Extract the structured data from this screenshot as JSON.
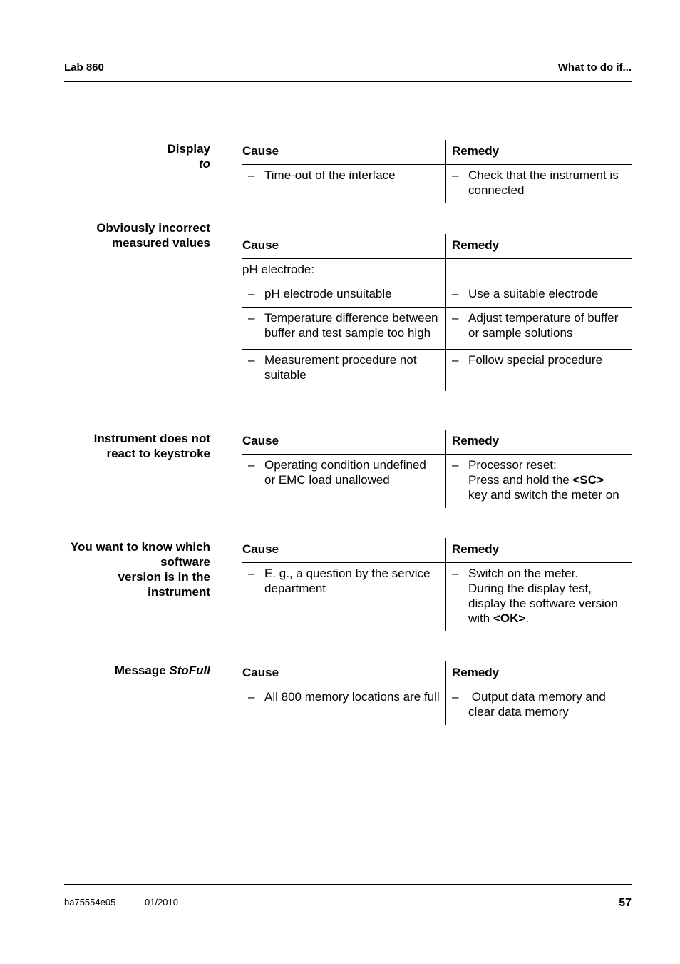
{
  "header": {
    "left": "Lab 860",
    "right": "What to do if..."
  },
  "footer": {
    "doc_id": "ba75554e05",
    "date": "01/2010",
    "page": "57"
  },
  "columns": {
    "cause": "Cause",
    "remedy": "Remedy"
  },
  "dash": "–",
  "sections": [
    {
      "label_line1": "Display",
      "label_line2_italic": "to",
      "rows": [
        {
          "cause": "Time-out of the interface",
          "remedy": "Check that the instrument is connected"
        }
      ]
    },
    {
      "label_line1": "Obviously incorrect",
      "label_line2": "measured values",
      "group_label": "pH electrode:",
      "rows": [
        {
          "cause": "pH electrode unsuitable",
          "remedy": "Use a suitable electrode"
        },
        {
          "cause": "Temperature difference between buffer and test sample too high",
          "remedy": "Adjust temperature of buffer or sample solutions"
        },
        {
          "cause": "Measurement procedure not suitable",
          "remedy": "Follow special procedure"
        }
      ]
    },
    {
      "label_line1": "Instrument does not",
      "label_line2": "react to keystroke",
      "rows": [
        {
          "cause": "Operating condition undefined or EMC load unallowed",
          "remedy_line1": "Processor reset:",
          "remedy_line2_pre": "Press and hold the ",
          "remedy_line2_key": "<SC>",
          "remedy_line3": "key and switch the meter on"
        }
      ]
    },
    {
      "label_line1": "You want to know which",
      "label_line2": "software",
      "label_line3": "version is in the",
      "label_line4": "instrument",
      "rows": [
        {
          "cause": "E. g., a question by the service department",
          "remedy_line1": "Switch on the meter.",
          "remedy_line2": "During the display test, display the software version with ",
          "remedy_key": "<OK>",
          "remedy_end": "."
        }
      ]
    },
    {
      "label_line1": "Message ",
      "label_italic": "StoFull",
      "rows": [
        {
          "cause": "All 800 memory locations are full",
          "remedy": " Output data memory and clear data memory"
        }
      ]
    }
  ]
}
